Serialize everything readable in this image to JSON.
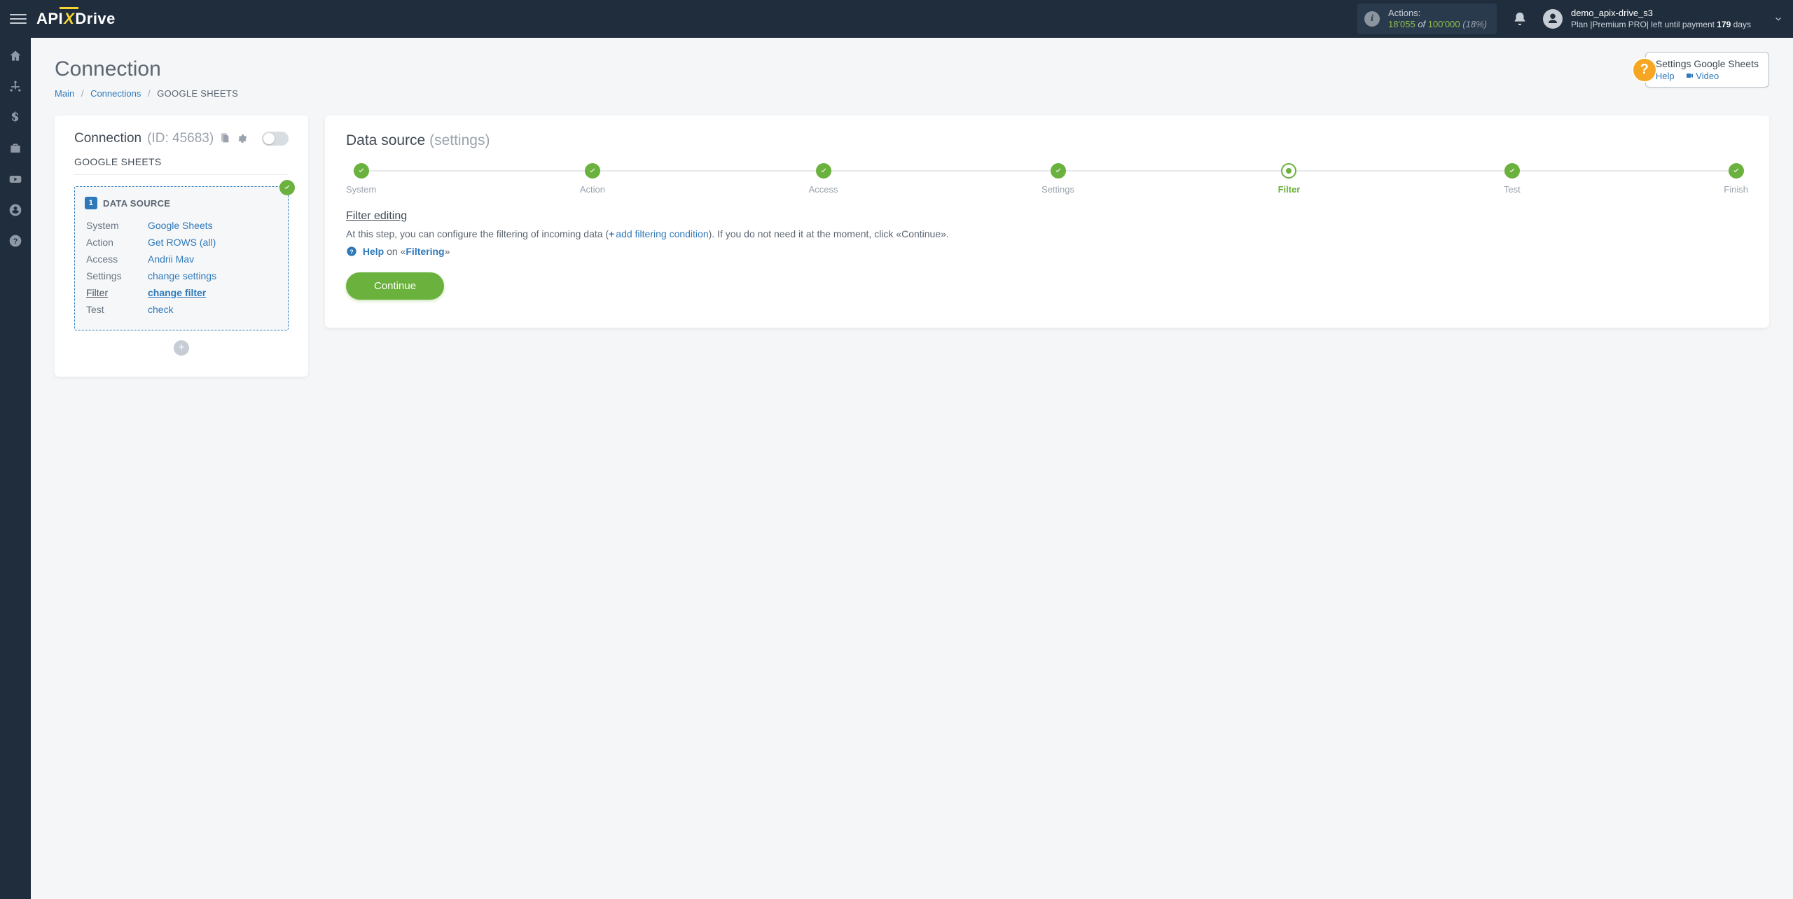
{
  "header": {
    "logo": {
      "part1": "API",
      "part2": "X",
      "part3": "Drive"
    },
    "actions": {
      "label": "Actions:",
      "used": "18'055",
      "of": "of",
      "total": "100'000",
      "pct": "(18%)"
    },
    "user": {
      "name": "demo_apix-drive_s3",
      "plan_prefix": "Plan |",
      "plan_name": "Premium PRO",
      "plan_mid": "| left until payment ",
      "days": "179",
      "days_suffix": " days"
    }
  },
  "page": {
    "title": "Connection",
    "breadcrumbs": {
      "main": "Main",
      "connections": "Connections",
      "current": "GOOGLE SHEETS"
    }
  },
  "helpWidget": {
    "title": "Settings Google Sheets",
    "help": "Help",
    "video": "Video"
  },
  "connCard": {
    "title": "Connection",
    "id_label": "(ID: 45683)",
    "system": "GOOGLE SHEETS",
    "ds_label": "DATA SOURCE",
    "rows": [
      {
        "k": "System",
        "v": "Google Sheets"
      },
      {
        "k": "Action",
        "v": "Get ROWS (all)"
      },
      {
        "k": "Access",
        "v": "Andrii Mav"
      },
      {
        "k": "Settings",
        "v": "change settings"
      },
      {
        "k": "Filter",
        "v": "change filter",
        "active": true
      },
      {
        "k": "Test",
        "v": "check"
      }
    ]
  },
  "panel": {
    "title": "Data source",
    "subtitle": "(settings)",
    "steps": [
      "System",
      "Action",
      "Access",
      "Settings",
      "Filter",
      "Test",
      "Finish"
    ],
    "current_step": 4,
    "filter_title": "Filter editing",
    "desc_pre": "At this step, you can configure the filtering of incoming data (",
    "add_cond": "add filtering condition",
    "desc_post": "). If you do not need it at the moment, click «Continue».",
    "help_label": "Help",
    "help_on": " on «",
    "help_topic": "Filtering",
    "help_close": "»",
    "continue": "Continue"
  }
}
